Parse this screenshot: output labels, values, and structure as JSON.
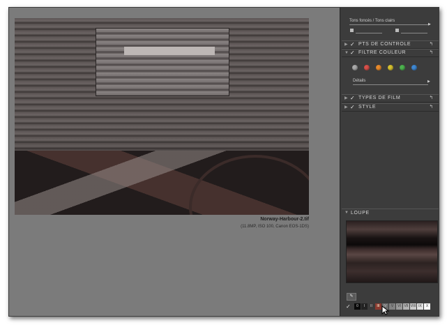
{
  "canvas": {
    "filename": "Norway-Harbour-2.tif",
    "info": "(11.8MP, ISO 100, Canon EOS-1DS)"
  },
  "panel": {
    "tone_label": "Tons foncés / Tons clairs",
    "sections": [
      {
        "label": "PTS DE CONTROLE",
        "checked": true,
        "expanded": false
      },
      {
        "label": "FILTRE COULEUR",
        "checked": true,
        "expanded": true
      },
      {
        "label": "TYPES DE FILM",
        "checked": true,
        "expanded": false
      },
      {
        "label": "STYLE",
        "checked": true,
        "expanded": false
      }
    ],
    "details_label": "Détails",
    "swatch_colors": [
      "#a9a9a9",
      "#d8504a",
      "#e88a2c",
      "#d6c130",
      "#4db34f",
      "#3f88d2"
    ],
    "loupe_label": "LOUPE",
    "zone_labels": [
      "0",
      "I",
      "II",
      "III",
      "IV",
      "V",
      "VI",
      "VII",
      "VIII",
      "IX",
      "X"
    ]
  }
}
